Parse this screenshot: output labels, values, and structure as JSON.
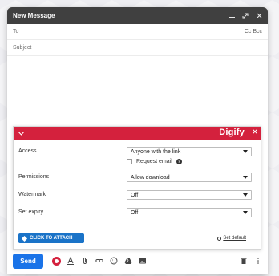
{
  "compose": {
    "title": "New Message",
    "to_label": "To",
    "cc_bcc": "Cc Bcc",
    "subject_placeholder": "Subject"
  },
  "titlebar_icons": [
    "minimize-icon",
    "expand-icon",
    "close-icon"
  ],
  "digify": {
    "logo": "Digify",
    "fields": {
      "access": {
        "label": "Access",
        "value": "Anyone with the link"
      },
      "request_email": "Request email",
      "permissions": {
        "label": "Permissions",
        "value": "Allow download"
      },
      "watermark": {
        "label": "Watermark",
        "value": "Off"
      },
      "expiry": {
        "label": "Set expiry",
        "value": "Off"
      }
    },
    "attach_button": "CLICK TO ATTACH",
    "set_default": "Set default",
    "header_color": "#d4213d"
  },
  "toolbar": {
    "send_label": "Send",
    "send_color": "#1a73e8",
    "tools": [
      "digify-icon",
      "format-text-icon",
      "attach-icon",
      "link-icon",
      "emoji-icon",
      "drive-icon",
      "photo-icon"
    ]
  }
}
